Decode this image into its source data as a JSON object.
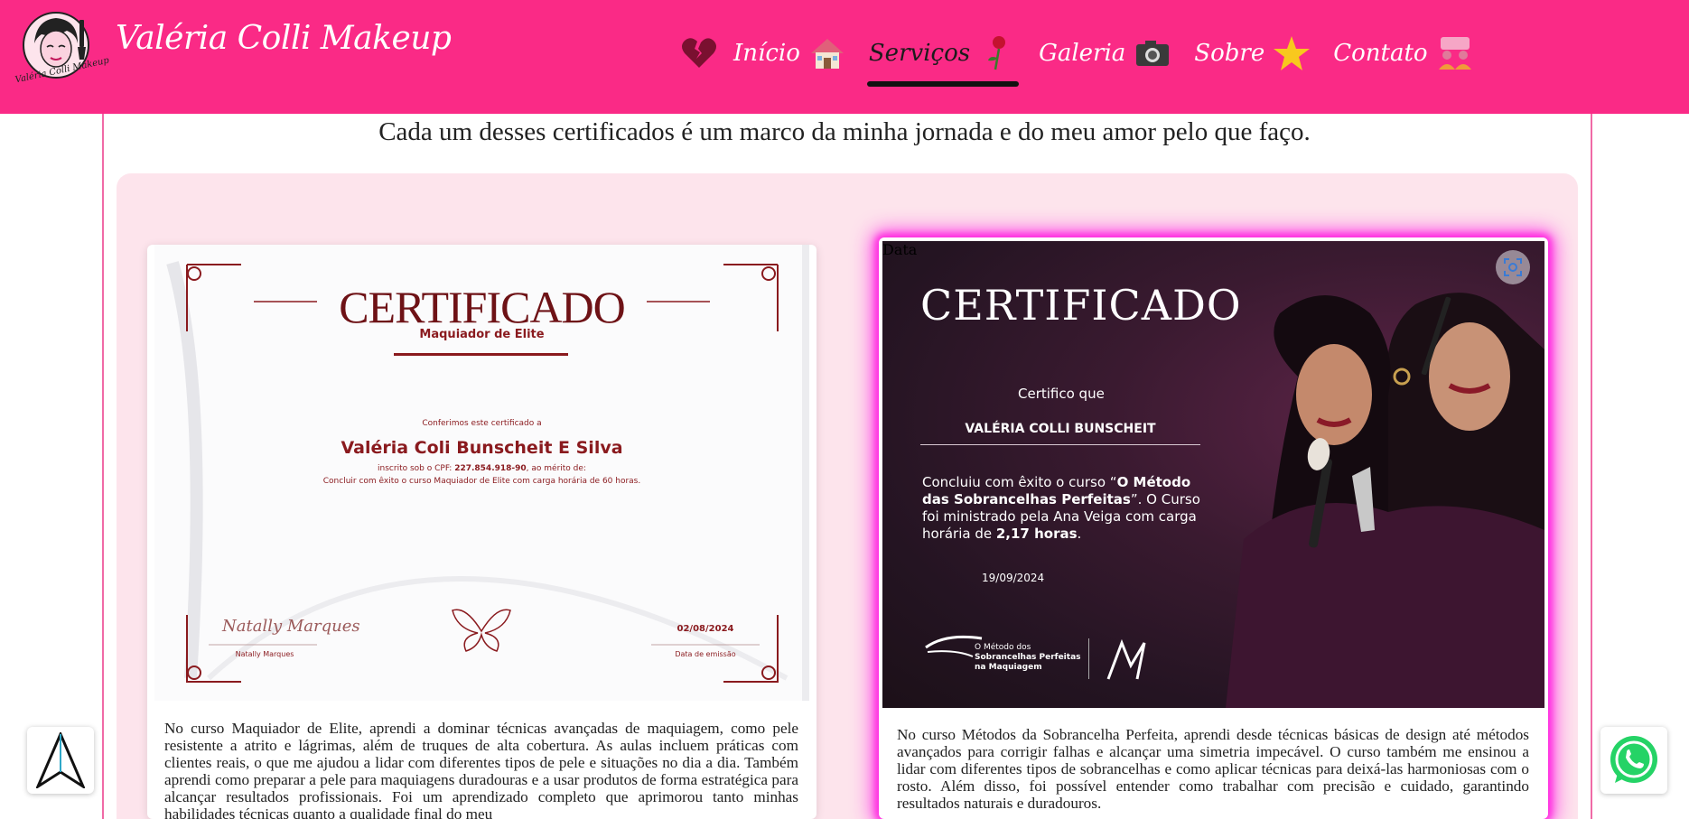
{
  "header": {
    "brand": "Valéria Colli Makeup",
    "logo_text": "Valéria Colli Makeup",
    "nav": [
      {
        "label": "Início",
        "icon": "house-icon"
      },
      {
        "label": "Serviços",
        "icon": "rose-icon",
        "active": true
      },
      {
        "label": "Galeria",
        "icon": "camera-icon"
      },
      {
        "label": "Sobre",
        "icon": "star-icon"
      },
      {
        "label": "Contato",
        "icon": "contact-people-icon"
      }
    ],
    "heart_icon": "broken-heart-icon",
    "colors": {
      "background": "#fa2a86",
      "active_indicator": "#111111"
    }
  },
  "main": {
    "tagline": "Cada um desses certificados é um marco da minha jornada e do meu amor pelo que faço.",
    "panel_color": "#fde4ec",
    "certificates": [
      {
        "title": "CERTIFICADO",
        "subtitle": "Maquiador de Elite",
        "confirm_text": "Conferimos este certificado a",
        "name": "Valéria Coli Bunscheit E Silva",
        "cpf_prefix": "inscrito sob o CPF:",
        "cpf": "227.854.918-90",
        "cpf_suffix": ", ao mérito de:",
        "course_line": "Concluir com êxito o curso Maquiador de Elite com carga horária de 60 horas.",
        "signature": "Natally Marques",
        "signer_name": "Natally Marques",
        "date": "02/08/2024",
        "date_label": "Data de emissão",
        "description": "No curso Maquiador de Elite, aprendi a dominar técnicas avançadas de maquiagem, como pele resistente a atrito e lágrimas, além de truques de alta cobertura. As aulas incluem práticas com clientes reais, o que me ajudou a lidar com diferentes tipos de pele e situações no dia a dia. Também aprendi como preparar a pele para maquiagens duradouras e a usar produtos de forma estratégica para alcançar resultados profissionais. Foi um aprendizado completo que aprimorou tanto minhas habilidades técnicas quanto a qualidade final do meu"
      },
      {
        "title": "CERTIFICADO",
        "certify_text": "Certifico que",
        "name": "VALÉRIA COLLI BUNSCHEIT",
        "body_prefix": "Concluiu com êxito o curso “",
        "course_name": "O Método das Sobrancelhas Perfeitas",
        "body_mid": "”. O Curso foi ministrado pela Ana Veiga com carga horária de ",
        "hours": "2,17 horas",
        "body_end": ".",
        "date_label": "Data",
        "date": "19/09/2024",
        "logo_line1": "O Método dos",
        "logo_line2": "Sobrancelhas Perfeitas",
        "logo_line3": "na Maquiagem",
        "description": "No curso Métodos da Sobrancelha Perfeita, aprendi desde técnicas básicas de design até métodos avançados para corrigir falhas e alcançar uma simetria impecável. O curso também me ensinou a lidar com diferentes tipos de sobrancelhas e como aplicar técnicas para deixá-las harmoniosas com o rosto. Além disso, foi possível entender como trabalhar com precisão e cuidado, garantindo resultados naturais e duradouros.",
        "highlight_color": "#ff2ae0"
      }
    ]
  },
  "floating": {
    "left_icon": "navigation-arrow-icon",
    "right_icon": "whatsapp-icon",
    "whatsapp_color": "#25d366"
  }
}
